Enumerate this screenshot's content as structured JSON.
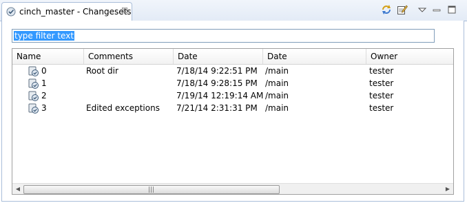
{
  "tab": {
    "title": "cinch_master - Changesets",
    "close_glyph": "☒"
  },
  "toolbar": {
    "icons": [
      "sync-icon",
      "edit-icon",
      "view-menu-icon",
      "minimize-icon",
      "maximize-icon"
    ]
  },
  "filter": {
    "value": "type filter text"
  },
  "table": {
    "columns": [
      "Name",
      "Comments",
      "Date",
      "Date",
      "Owner"
    ],
    "rows": [
      {
        "name": "0",
        "comments": "Root dir",
        "date": "7/18/14 9:22:51 PM",
        "branch": "/main",
        "owner": "tester"
      },
      {
        "name": "1",
        "comments": "",
        "date": "7/18/14 9:28:15 PM",
        "branch": "/main",
        "owner": "tester"
      },
      {
        "name": "2",
        "comments": "",
        "date": "7/19/14 12:19:14 AM",
        "branch": "/main",
        "owner": "tester"
      },
      {
        "name": "3",
        "comments": "Edited exceptions",
        "date": "7/21/14 2:31:31 PM",
        "branch": "/main",
        "owner": "tester"
      }
    ]
  },
  "scrollbar": {
    "left_arrow": "◀",
    "right_arrow": "▶",
    "grip": "|||"
  }
}
